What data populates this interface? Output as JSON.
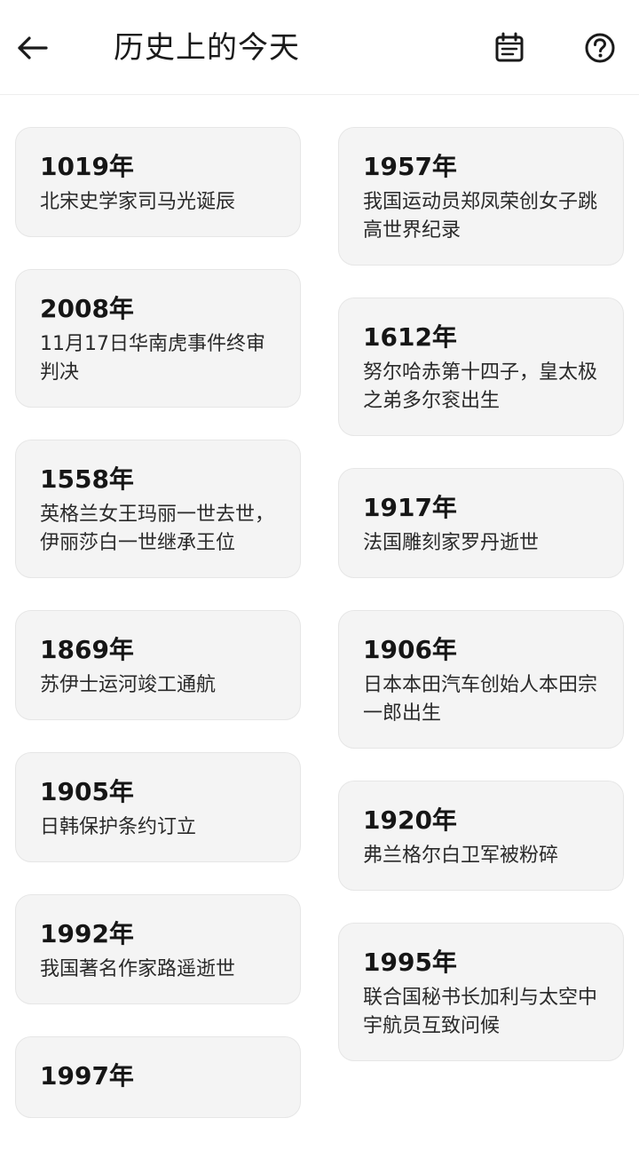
{
  "header": {
    "title": "历史上的今天",
    "back_icon": "arrow-left-icon",
    "calendar_icon": "calendar-icon",
    "help_icon": "help-circle-icon"
  },
  "events": {
    "left": [
      {
        "year": "1019年",
        "text": "北宋史学家司马光诞辰"
      },
      {
        "year": "2008年",
        "text": "11月17日华南虎事件终审判决"
      },
      {
        "year": "1558年",
        "text": "英格兰女王玛丽一世去世，伊丽莎白一世继承王位"
      },
      {
        "year": "1869年",
        "text": "苏伊士运河竣工通航"
      },
      {
        "year": "1905年",
        "text": "日韩保护条约订立"
      },
      {
        "year": "1992年",
        "text": "我国著名作家路遥逝世"
      },
      {
        "year": "1997年",
        "text": ""
      }
    ],
    "right": [
      {
        "year": "1957年",
        "text": "我国运动员郑凤荣创女子跳高世界纪录"
      },
      {
        "year": "1612年",
        "text": "努尔哈赤第十四子，皇太极之弟多尔衮出生"
      },
      {
        "year": "1917年",
        "text": "法国雕刻家罗丹逝世"
      },
      {
        "year": "1906年",
        "text": "日本本田汽车创始人本田宗一郎出生"
      },
      {
        "year": "1920年",
        "text": "弗兰格尔白卫军被粉碎"
      },
      {
        "year": "1995年",
        "text": "联合国秘书长加利与太空中宇航员互致问候"
      }
    ]
  }
}
